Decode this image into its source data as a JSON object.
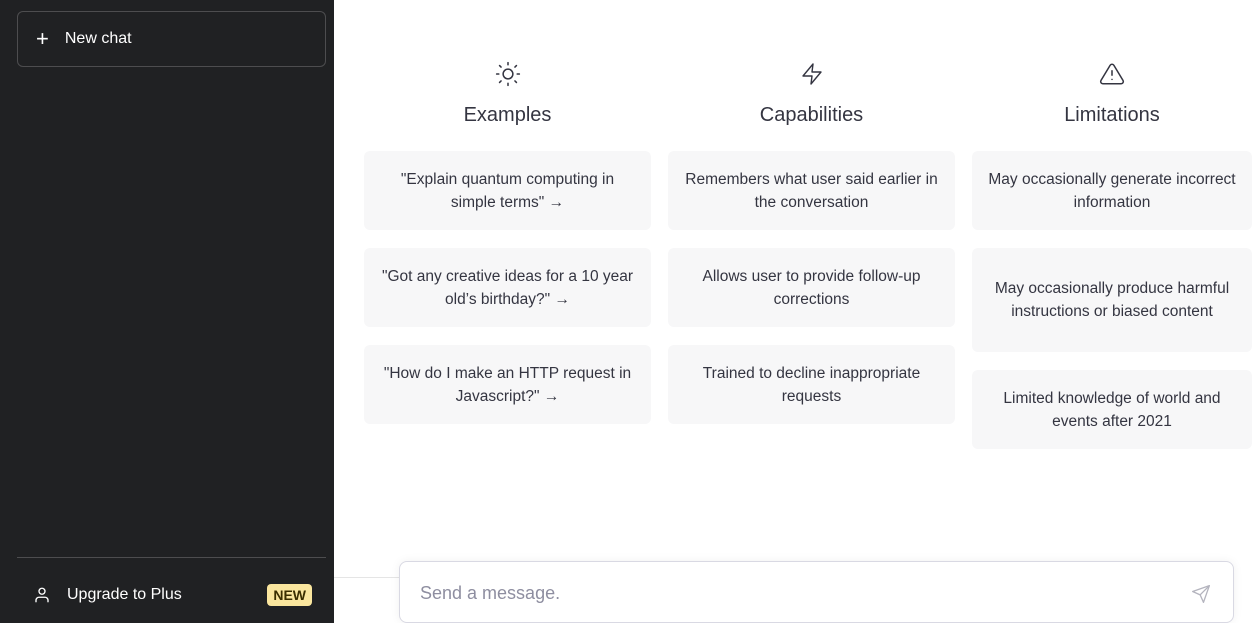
{
  "sidebar": {
    "new_chat_label": "New chat",
    "upgrade_label": "Upgrade to Plus",
    "upgrade_badge": "NEW",
    "background": "#202123",
    "badge_color": "#fae69e"
  },
  "columns": [
    {
      "icon": "sun-icon",
      "title": "Examples",
      "items": [
        "\"Explain quantum computing in simple terms\" →",
        "\"Got any creative ideas for a 10 year old’s birthday?\" →",
        "\"How do I make an HTTP request in Javascript?\" →"
      ]
    },
    {
      "icon": "lightning-icon",
      "title": "Capabilities",
      "items": [
        "Remembers what user said earlier in the conversation",
        "Allows user to provide follow-up corrections",
        "Trained to decline inappropriate requests"
      ]
    },
    {
      "icon": "warning-icon",
      "title": "Limitations",
      "items": [
        "May occasionally generate incorrect information",
        "May occasionally produce harmful instructions or biased content",
        "Limited knowledge of world and events after 2021"
      ]
    }
  ],
  "composer": {
    "placeholder": "Send a message.",
    "value": "",
    "send_icon": "send-icon"
  }
}
